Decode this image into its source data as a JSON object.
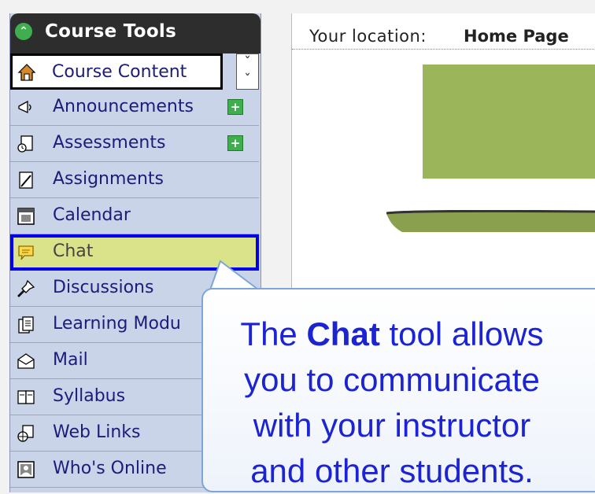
{
  "sidebar": {
    "title": "Course Tools",
    "items": [
      {
        "label": "Course Content",
        "icon": "home-icon"
      },
      {
        "label": "Announcements",
        "icon": "megaphone-icon",
        "new": true
      },
      {
        "label": "Assessments",
        "icon": "quiz-icon",
        "new": true
      },
      {
        "label": "Assignments",
        "icon": "assignment-icon"
      },
      {
        "label": "Calendar",
        "icon": "calendar-icon"
      },
      {
        "label": "Chat",
        "icon": "chat-bubble-icon"
      },
      {
        "label": "Discussions",
        "icon": "pin-icon"
      },
      {
        "label": "Learning Modu",
        "icon": "document-icon"
      },
      {
        "label": "Mail",
        "icon": "mail-icon"
      },
      {
        "label": "Syllabus",
        "icon": "syllabus-icon"
      },
      {
        "label": "Web Links",
        "icon": "web-links-icon"
      },
      {
        "label": "Who's Online",
        "icon": "who-online-icon"
      }
    ],
    "toggle_glyph": "»"
  },
  "location": {
    "label": "Your location:",
    "value": "Home Page"
  },
  "callout": {
    "line1_pre": "The ",
    "line1_bold": "Chat",
    "line1_post": " tool allows",
    "line2": "you to communicate",
    "line3": "with your instructor",
    "line4": "and other students."
  },
  "colors": {
    "sidebar_bg": "#c9d4e8",
    "header_bg": "#2d2d2d",
    "accent_green": "#9ab55a",
    "highlight": "#dbe38a",
    "callout_text": "#1b23d3"
  }
}
